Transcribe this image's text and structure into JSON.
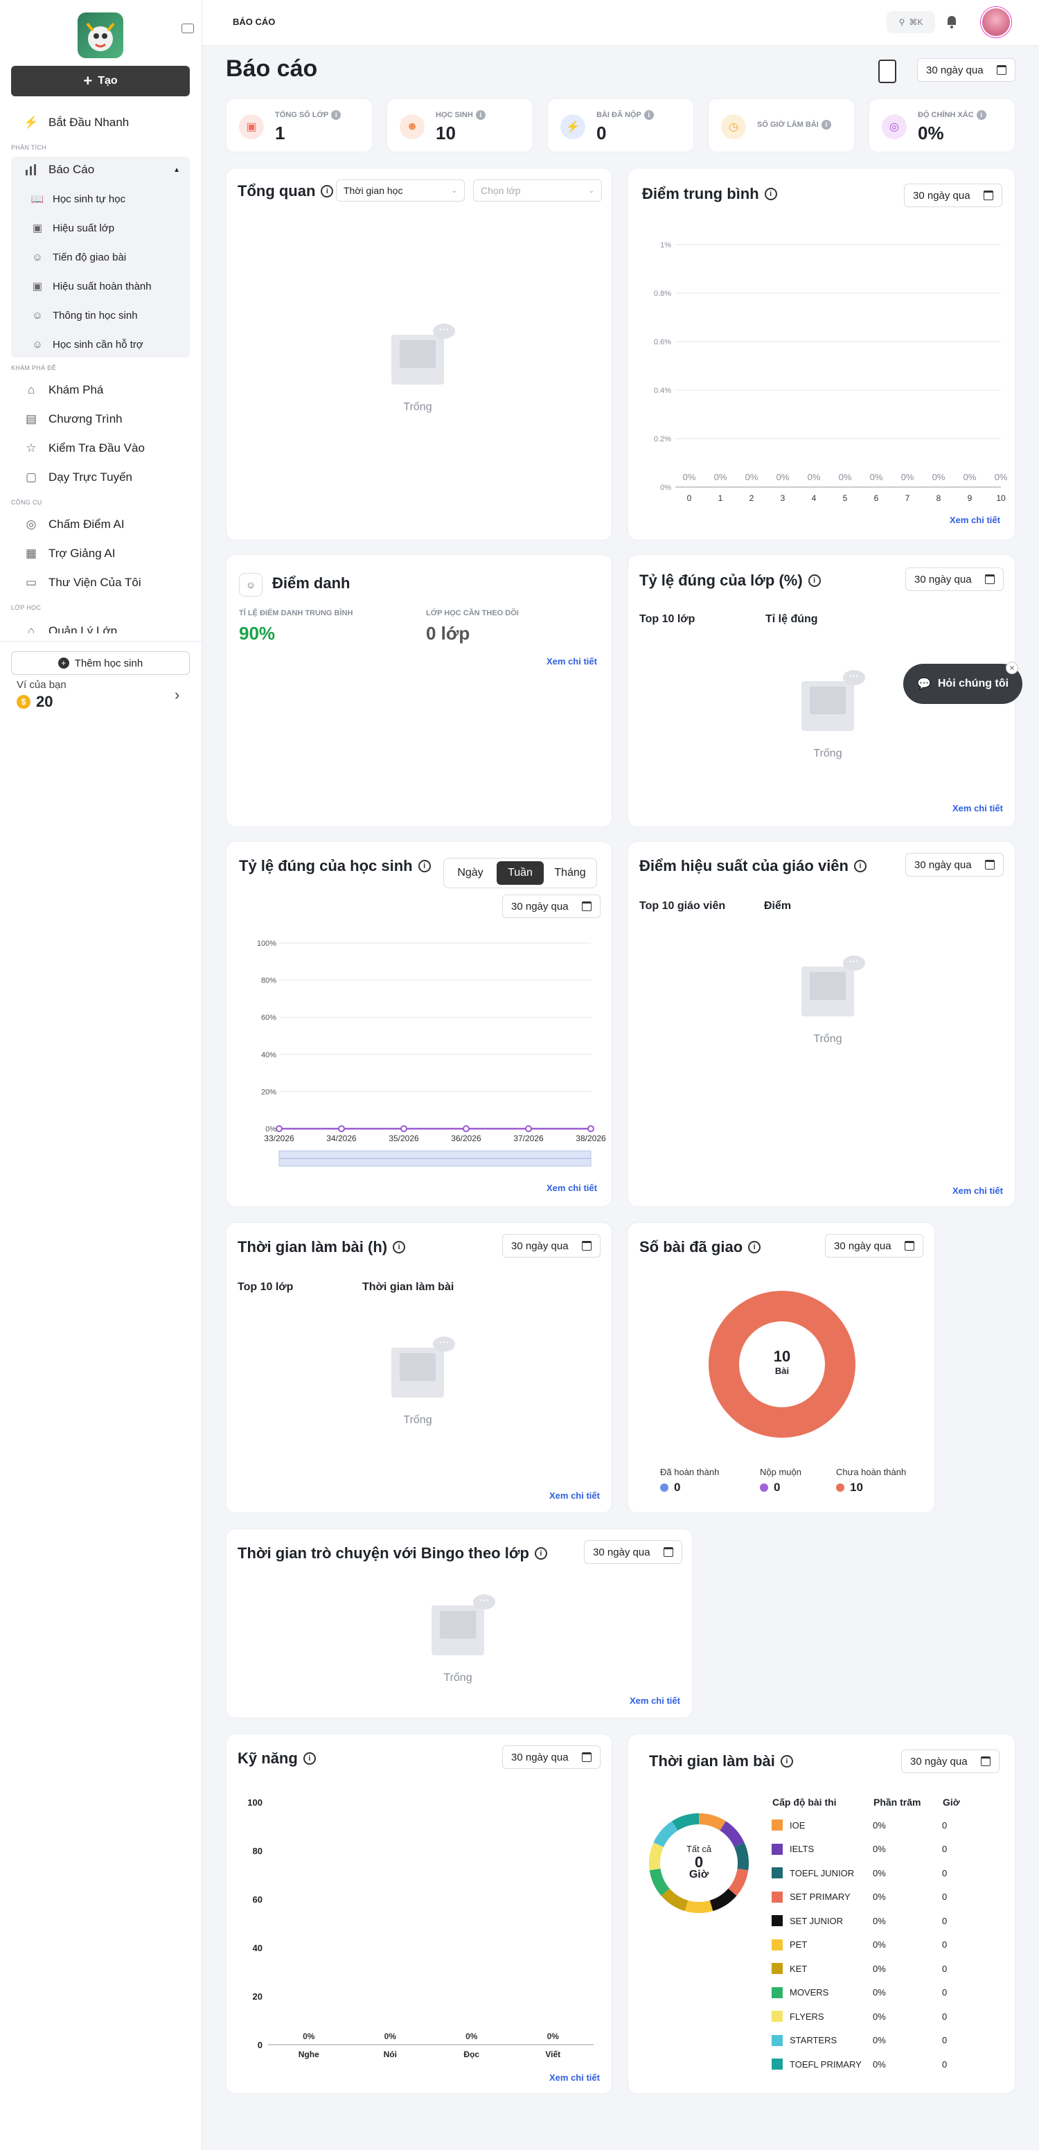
{
  "sidebar": {
    "create_label": "Tạo",
    "quick_start": "Bắt Đầu Nhanh",
    "section_analysis": "PHÂN TÍCH",
    "reports": "Báo Cáo",
    "report_sub": [
      "Học sinh tự học",
      "Hiệu suất lớp",
      "Tiến độ giao bài",
      "Hiệu suất hoàn thành",
      "Thông tin học sinh",
      "Học sinh cần hỗ trợ"
    ],
    "section_explore": "KHÁM PHÁ ĐỀ",
    "explore_items": [
      "Khám Phá",
      "Chương Trình",
      "Kiểm Tra Đầu Vào",
      "Dạy Trực Tuyến"
    ],
    "section_tools": "CÔNG CỤ",
    "tool_items": [
      "Chấm Điểm AI",
      "Trợ Giảng AI",
      "Thư Viện Của Tôi"
    ],
    "section_class": "LỚP HỌC",
    "class_item": "Quản Lý Lớp",
    "add_student": "Thêm học sinh",
    "wallet_label": "Ví của bạn",
    "wallet_value": "20"
  },
  "topbar": {
    "breadcrumb": "BÁO CÁO",
    "search_shortcut": "⌘K"
  },
  "page": {
    "title": "Báo cáo",
    "date_range": "30 ngày qua"
  },
  "stats": [
    {
      "label": "TỔNG SỐ LỚP",
      "value": "1",
      "color": "#f26b5b"
    },
    {
      "label": "HỌC SINH",
      "value": "10",
      "color": "#f08a4b"
    },
    {
      "label": "BÀI ĐÃ NỘP",
      "value": "0",
      "color": "#3d6fe6"
    },
    {
      "label": "SỐ GIỜ LÀM BÀI",
      "value": "",
      "color": "#f5a623"
    },
    {
      "label": "ĐỘ CHÍNH XÁC",
      "value": "0%",
      "color": "#b04fd6"
    }
  ],
  "overview": {
    "title": "Tổng quan",
    "filter_time": "Thời gian học",
    "filter_class_placeholder": "Chọn lớp",
    "empty": "Trống"
  },
  "avg_score": {
    "title": "Điểm trung bình",
    "date_range": "30 ngày qua",
    "link": "Xem chi tiết",
    "chart_data": {
      "type": "bar",
      "categories": [
        "0",
        "1",
        "2",
        "3",
        "4",
        "5",
        "6",
        "7",
        "8",
        "9",
        "10"
      ],
      "values": [
        0,
        0,
        0,
        0,
        0,
        0,
        0,
        0,
        0,
        0,
        0
      ],
      "data_labels": [
        "0%",
        "0%",
        "0%",
        "0%",
        "0%",
        "0%",
        "0%",
        "0%",
        "0%",
        "0%",
        "0%"
      ],
      "y_ticks": [
        "0%",
        "0.2%",
        "0.4%",
        "0.6%",
        "0.8%",
        "1%"
      ],
      "ylim": [
        0,
        1
      ],
      "grid": true
    }
  },
  "attendance": {
    "title": "Điểm danh",
    "avg_label": "TỈ LỆ ĐIỂM DANH TRUNG BÌNH",
    "avg_value": "90%",
    "follow_label": "LỚP HỌC CẦN THEO DÕI",
    "follow_value": "0 lớp",
    "link": "Xem chi tiết"
  },
  "class_accuracy": {
    "title": "Tỷ lệ đúng của lớp (%)",
    "date_range": "30 ngày qua",
    "col1": "Top 10 lớp",
    "col2": "Tỉ lệ đúng",
    "empty": "Trống",
    "link": "Xem chi tiết"
  },
  "student_accuracy": {
    "title": "Tỷ lệ đúng của học sinh",
    "tabs": [
      "Ngày",
      "Tuần",
      "Tháng"
    ],
    "active_tab": "Tuần",
    "date_range": "30 ngày qua",
    "link": "Xem chi tiết",
    "chart_data": {
      "type": "line",
      "x": [
        "33/2026",
        "34/2026",
        "35/2026",
        "36/2026",
        "37/2026",
        "38/2026"
      ],
      "values": [
        0,
        0,
        0,
        0,
        0,
        0
      ],
      "y_ticks": [
        "0%",
        "20%",
        "40%",
        "60%",
        "80%",
        "100%"
      ],
      "ylim": [
        0,
        100
      ],
      "grid": true
    }
  },
  "teacher_perf": {
    "title": "Điểm hiệu suất của giáo viên",
    "date_range": "30 ngày qua",
    "col1": "Top 10 giáo viên",
    "col2": "Điểm",
    "empty": "Trống",
    "link": "Xem chi tiết"
  },
  "work_time": {
    "title": "Thời gian làm bài (h)",
    "date_range": "30 ngày qua",
    "col1": "Top 10 lớp",
    "col2": "Thời gian làm bài",
    "empty": "Trống",
    "link": "Xem chi tiết"
  },
  "assigned": {
    "title": "Số bài đã giao",
    "date_range": "30 ngày qua",
    "center_value": "10",
    "center_unit": "Bài",
    "chart_data": {
      "type": "pie",
      "labels": [
        "Đã hoàn thành",
        "Nộp muộn",
        "Chưa hoàn thành"
      ],
      "values": [
        0,
        0,
        10
      ],
      "colors": [
        "#6b8fe8",
        "#a064d8",
        "#e8735a"
      ]
    }
  },
  "bingo": {
    "title": "Thời gian trò chuyện với Bingo theo lớp",
    "date_range": "30 ngày qua",
    "empty": "Trống",
    "link": "Xem chi tiết"
  },
  "skills": {
    "title": "Kỹ năng",
    "date_range": "30 ngày qua",
    "link": "Xem chi tiết",
    "chart_data": {
      "type": "bar",
      "categories": [
        "Nghe",
        "Nói",
        "Đọc",
        "Viết"
      ],
      "values": [
        0,
        0,
        0,
        0
      ],
      "data_labels": [
        "0%",
        "0%",
        "0%",
        "0%"
      ],
      "y_ticks": [
        "0",
        "20",
        "40",
        "60",
        "80",
        "100"
      ],
      "ylim": [
        0,
        100
      ]
    }
  },
  "exam_time": {
    "title": "Thời gian làm bài",
    "date_range": "30 ngày qua",
    "center_label": "Tất cả",
    "center_value": "0",
    "center_unit": "Giờ",
    "headers": [
      "Cấp độ bài thi",
      "Phần trăm",
      "Giờ"
    ],
    "chart_data": {
      "type": "pie",
      "rows": [
        {
          "name": "IOE",
          "percent": "0%",
          "hours": "0",
          "color": "#f59a3c"
        },
        {
          "name": "IELTS",
          "percent": "0%",
          "hours": "0",
          "color": "#6b3fb3"
        },
        {
          "name": "TOEFL JUNIOR",
          "percent": "0%",
          "hours": "0",
          "color": "#1f6b73"
        },
        {
          "name": "SET PRIMARY",
          "percent": "0%",
          "hours": "0",
          "color": "#ea6e55"
        },
        {
          "name": "SET JUNIOR",
          "percent": "0%",
          "hours": "0",
          "color": "#111111"
        },
        {
          "name": "PET",
          "percent": "0%",
          "hours": "0",
          "color": "#f7c531"
        },
        {
          "name": "KET",
          "percent": "0%",
          "hours": "0",
          "color": "#c7a010"
        },
        {
          "name": "MOVERS",
          "percent": "0%",
          "hours": "0",
          "color": "#2fb36b"
        },
        {
          "name": "FLYERS",
          "percent": "0%",
          "hours": "0",
          "color": "#f4e56a"
        },
        {
          "name": "STARTERS",
          "percent": "0%",
          "hours": "0",
          "color": "#4fc3d6"
        },
        {
          "name": "TOEFL PRIMARY",
          "percent": "0%",
          "hours": "0",
          "color": "#1aa39a"
        }
      ]
    }
  },
  "chat_button": "Hỏi chúng tôi"
}
